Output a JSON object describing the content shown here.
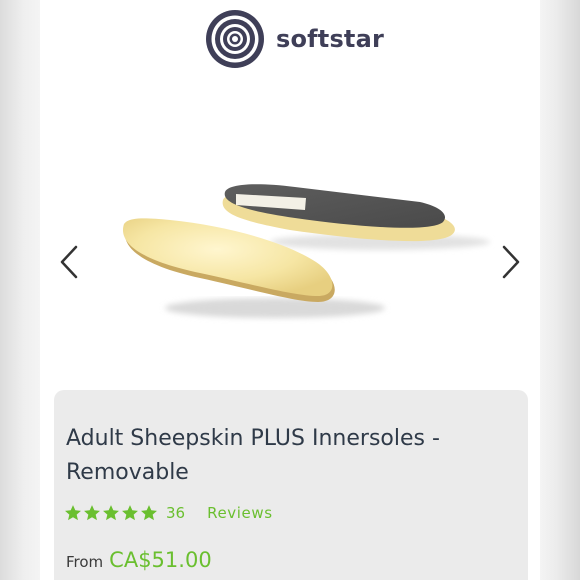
{
  "header": {
    "brand_name": "softstar",
    "logo_icon": "concentric-circles-logo-icon",
    "brand_color": "#3f3f58"
  },
  "carousel": {
    "prev_icon": "chevron-left-icon",
    "next_icon": "chevron-right-icon",
    "image": "sheepskin-innersoles-product-image"
  },
  "product": {
    "title": "Adult Sheepskin PLUS Innersoles - Removable",
    "rating": {
      "stars": 5,
      "star_icon": "star-icon",
      "count": "36",
      "label": "Reviews"
    },
    "price": {
      "prefix": "From",
      "value": "CA$51.00"
    }
  },
  "colors": {
    "accent_green": "#6abf2f",
    "card_background": "#ebebeb",
    "title_text": "#2f3a48"
  }
}
